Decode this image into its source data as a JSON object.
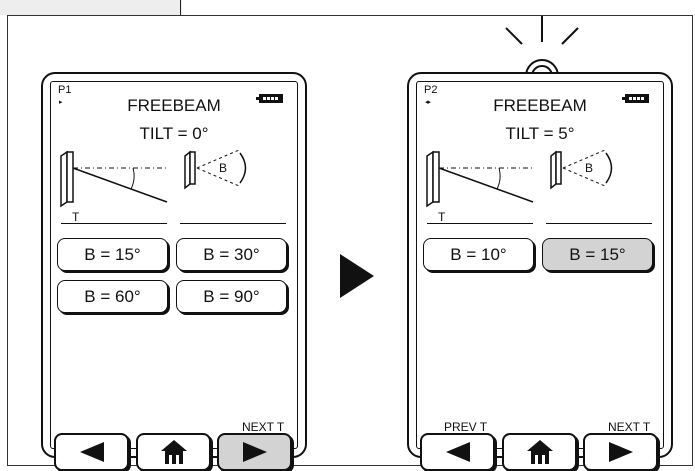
{
  "panels": [
    {
      "page_id": "P1",
      "nav_arrows": "▸",
      "title": "FREEBEAM",
      "tilt_text": "TILT = 0°",
      "tilt_diagram_label": "T",
      "beam_label": "B",
      "beam_buttons": [
        {
          "label": "B = 15°",
          "selected": false
        },
        {
          "label": "B = 30°",
          "selected": false
        },
        {
          "label": "B = 60°",
          "selected": false
        },
        {
          "label": "B = 90°",
          "selected": false
        }
      ],
      "prev_label": "",
      "next_label": "NEXT T",
      "nav_buttons": {
        "back_icon": "left-arrow-icon",
        "home_icon": "home-icon",
        "next_icon": "right-arrow-icon",
        "next_pressed": true
      },
      "light_on": false
    },
    {
      "page_id": "P2",
      "nav_arrows": "◂▸",
      "title": "FREEBEAM",
      "tilt_text": "TILT = 5°",
      "tilt_diagram_label": "T",
      "beam_label": "B",
      "beam_buttons": [
        {
          "label": "B = 10°",
          "selected": false
        },
        {
          "label": "B = 15°",
          "selected": true
        }
      ],
      "prev_label": "PREV T",
      "next_label": "NEXT T",
      "nav_buttons": {
        "back_icon": "left-arrow-icon",
        "home_icon": "home-icon",
        "next_icon": "right-arrow-icon",
        "next_pressed": false
      },
      "light_on": true
    }
  ],
  "transition_icon": "right-triangle-icon",
  "light_indicator_icon": "light-bulb-rays-icon",
  "colors": {
    "outline": "#111111",
    "pressed_button": "#d3d3d3",
    "sidebar": "#eeeeee"
  }
}
